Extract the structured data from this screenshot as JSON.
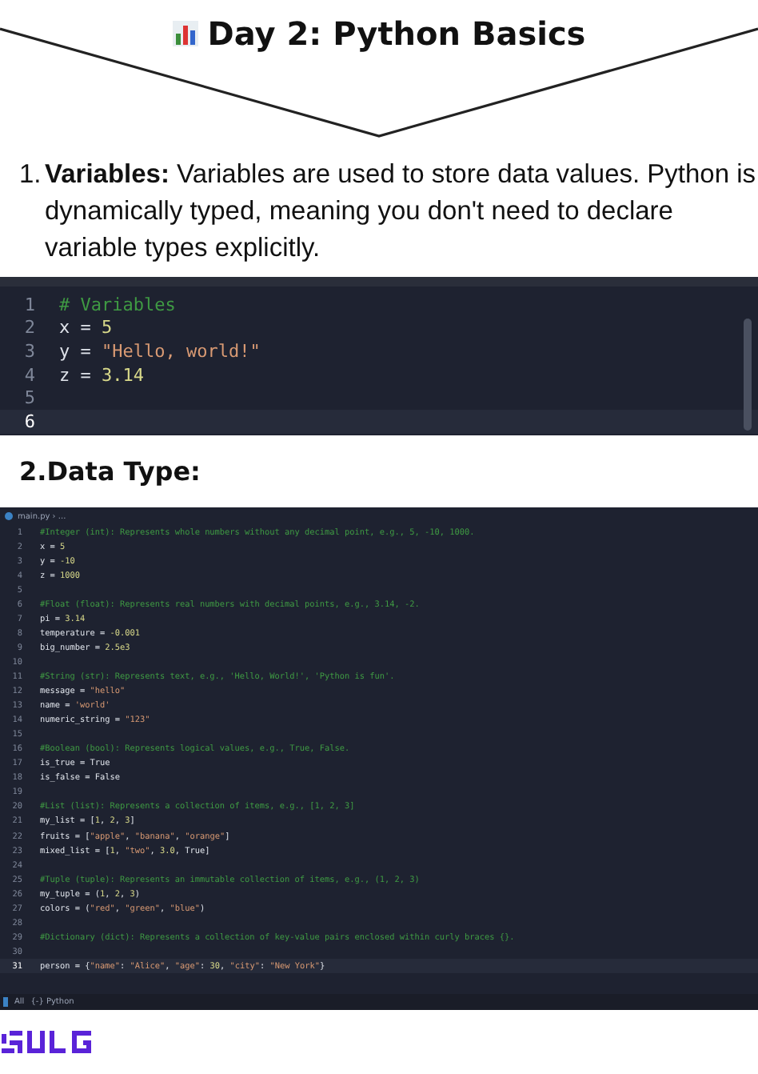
{
  "title": "Day 2: Python Basics",
  "points": [
    {
      "marker": "1.",
      "text": "**Variables:** Variables are used to store data values. Python is dynamically typed, meaning you don't need to declare variable types explicitly."
    }
  ],
  "editors": [
    {
      "kind": "compact",
      "lines": [
        {
          "number": "1",
          "current": false,
          "tokens": [
            {
              "kind": "comment",
              "text": "# Variables"
            }
          ]
        },
        {
          "number": "2",
          "current": false,
          "tokens": [
            {
              "kind": "text",
              "text": "x = "
            },
            {
              "kind": "number",
              "text": "5"
            }
          ]
        },
        {
          "number": "3",
          "current": false,
          "tokens": [
            {
              "kind": "text",
              "text": "y = "
            },
            {
              "kind": "string",
              "text": "\"Hello, world!\""
            }
          ]
        },
        {
          "number": "4",
          "current": false,
          "tokens": [
            {
              "kind": "text",
              "text": "z = "
            },
            {
              "kind": "number",
              "text": "3.14"
            }
          ]
        },
        {
          "number": "5",
          "current": false
        },
        {
          "number": "6",
          "current": true
        }
      ]
    },
    {
      "kind": "full",
      "tab": "main.py › ...",
      "status": [
        "All",
        "{-} Python"
      ],
      "lines": [
        {
          "number": "1",
          "current": false,
          "tokens": [
            {
              "kind": "comment",
              "text": "#Integer (int): Represents whole numbers without any decimal point, e.g., 5, -10, 1000."
            }
          ]
        },
        {
          "number": "2",
          "current": false,
          "tokens": [
            {
              "kind": "text",
              "text": "x = "
            },
            {
              "kind": "number",
              "text": "5"
            }
          ]
        },
        {
          "number": "3",
          "current": false,
          "tokens": [
            {
              "kind": "text",
              "text": "y = "
            },
            {
              "kind": "number",
              "text": "-10"
            }
          ]
        },
        {
          "number": "4",
          "current": false,
          "tokens": [
            {
              "kind": "text",
              "text": "z = "
            },
            {
              "kind": "number",
              "text": "1000"
            }
          ]
        },
        {
          "number": "5",
          "current": false
        },
        {
          "number": "6",
          "current": false,
          "tokens": [
            {
              "kind": "comment",
              "text": "#Float (float): Represents real numbers with decimal points, e.g., 3.14, -2."
            }
          ]
        },
        {
          "number": "7",
          "current": false,
          "tokens": [
            {
              "kind": "text",
              "text": "pi = "
            },
            {
              "kind": "number",
              "text": "3.14"
            }
          ]
        },
        {
          "number": "8",
          "current": false,
          "tokens": [
            {
              "kind": "text",
              "text": "temperature = "
            },
            {
              "kind": "number",
              "text": "-0.001"
            }
          ]
        },
        {
          "number": "9",
          "current": false,
          "tokens": [
            {
              "kind": "text",
              "text": "big_number = "
            },
            {
              "kind": "number",
              "text": "2.5e3"
            }
          ]
        },
        {
          "number": "10",
          "current": false
        },
        {
          "number": "11",
          "current": false,
          "tokens": [
            {
              "kind": "comment",
              "text": "#String (str): Represents text, e.g., 'Hello, World!', 'Python is fun'."
            }
          ]
        },
        {
          "number": "12",
          "current": false,
          "tokens": [
            {
              "kind": "text",
              "text": "message = "
            },
            {
              "kind": "string",
              "text": "\"hello\""
            }
          ]
        },
        {
          "number": "13",
          "current": false,
          "tokens": [
            {
              "kind": "text",
              "text": "name = "
            },
            {
              "kind": "string",
              "text": "'world'"
            }
          ]
        },
        {
          "number": "14",
          "current": false,
          "tokens": [
            {
              "kind": "text",
              "text": "numeric_string = "
            },
            {
              "kind": "string",
              "text": "\"123\""
            }
          ]
        },
        {
          "number": "15",
          "current": false
        },
        {
          "number": "16",
          "current": false,
          "tokens": [
            {
              "kind": "comment",
              "text": "#Boolean (bool): Represents logical values, e.g., True, False."
            }
          ]
        },
        {
          "number": "17",
          "current": false,
          "tokens": [
            {
              "kind": "text",
              "text": "is_true = "
            },
            {
              "kind": "constant",
              "text": "True"
            }
          ]
        },
        {
          "number": "18",
          "current": false,
          "tokens": [
            {
              "kind": "text",
              "text": "is_false = "
            },
            {
              "kind": "constant",
              "text": "False"
            }
          ]
        },
        {
          "number": "19",
          "current": false
        },
        {
          "number": "20",
          "current": false,
          "tokens": [
            {
              "kind": "comment",
              "text": "#List (list): Represents a collection of items, e.g., [1, 2, 3]"
            }
          ]
        },
        {
          "number": "21",
          "current": false,
          "tokens": [
            {
              "kind": "text",
              "text": "my_list = ["
            },
            {
              "kind": "number",
              "text": "1"
            },
            {
              "kind": "text",
              "text": ", "
            },
            {
              "kind": "number",
              "text": "2"
            },
            {
              "kind": "text",
              "text": ", "
            },
            {
              "kind": "number",
              "text": "3"
            },
            {
              "kind": "text",
              "text": "]"
            }
          ]
        },
        {
          "number": "22",
          "current": false,
          "tokens": [
            {
              "kind": "text",
              "text": "fruits = ["
            },
            {
              "kind": "string",
              "text": "\"apple\""
            },
            {
              "kind": "text",
              "text": ", "
            },
            {
              "kind": "string",
              "text": "\"banana\""
            },
            {
              "kind": "text",
              "text": ", "
            },
            {
              "kind": "string",
              "text": "\"orange\""
            },
            {
              "kind": "text",
              "text": "]"
            }
          ]
        },
        {
          "number": "23",
          "current": false,
          "tokens": [
            {
              "kind": "text",
              "text": "mixed_list = ["
            },
            {
              "kind": "number",
              "text": "1"
            },
            {
              "kind": "text",
              "text": ", "
            },
            {
              "kind": "string",
              "text": "\"two\""
            },
            {
              "kind": "text",
              "text": ", "
            },
            {
              "kind": "number",
              "text": "3.0"
            },
            {
              "kind": "text",
              "text": ", "
            },
            {
              "kind": "constant",
              "text": "True"
            },
            {
              "kind": "text",
              "text": "]"
            }
          ]
        },
        {
          "number": "24",
          "current": false
        },
        {
          "number": "25",
          "current": false,
          "tokens": [
            {
              "kind": "comment",
              "text": "#Tuple (tuple): Represents an immutable collection of items, e.g., (1, 2, 3)"
            }
          ]
        },
        {
          "number": "26",
          "current": false,
          "tokens": [
            {
              "kind": "text",
              "text": "my_tuple = ("
            },
            {
              "kind": "number",
              "text": "1"
            },
            {
              "kind": "text",
              "text": ", "
            },
            {
              "kind": "number",
              "text": "2"
            },
            {
              "kind": "text",
              "text": ", "
            },
            {
              "kind": "number",
              "text": "3"
            },
            {
              "kind": "text",
              "text": ")"
            }
          ]
        },
        {
          "number": "27",
          "current": false,
          "tokens": [
            {
              "kind": "text",
              "text": "colors = ("
            },
            {
              "kind": "string",
              "text": "\"red\""
            },
            {
              "kind": "text",
              "text": ", "
            },
            {
              "kind": "string",
              "text": "\"green\""
            },
            {
              "kind": "text",
              "text": ", "
            },
            {
              "kind": "string",
              "text": "\"blue\""
            },
            {
              "kind": "text",
              "text": ")"
            }
          ]
        },
        {
          "number": "28",
          "current": false
        },
        {
          "number": "29",
          "current": false,
          "tokens": [
            {
              "kind": "comment",
              "text": "#Dictionary (dict): Represents a collection of key-value pairs enclosed within curly braces {}."
            }
          ]
        },
        {
          "number": "30",
          "current": false
        },
        {
          "number": "31",
          "current": true,
          "tokens": [
            {
              "kind": "text",
              "text": "person = {"
            },
            {
              "kind": "string",
              "text": "\"name\""
            },
            {
              "kind": "text",
              "text": ": "
            },
            {
              "kind": "string",
              "text": "\"Alice\""
            },
            {
              "kind": "text",
              "text": ", "
            },
            {
              "kind": "string",
              "text": "\"age\""
            },
            {
              "kind": "text",
              "text": ": "
            },
            {
              "kind": "number",
              "text": "30"
            },
            {
              "kind": "text",
              "text": ", "
            },
            {
              "kind": "string",
              "text": "\"city\""
            },
            {
              "kind": "text",
              "text": ": "
            },
            {
              "kind": "string",
              "text": "\"New York\""
            },
            {
              "kind": "text",
              "text": "}"
            }
          ]
        }
      ]
    }
  ],
  "section": "2.Data Type:"
}
